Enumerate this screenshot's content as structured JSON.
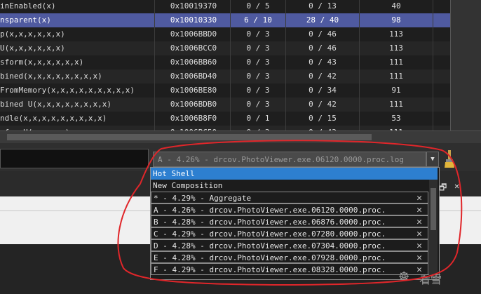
{
  "table": {
    "rows": [
      {
        "name": "inEnabled(x)",
        "address": "0x10019370",
        "col1": "0 / 5",
        "col2": "0 / 13",
        "col3": "40",
        "selected": false
      },
      {
        "name": "nsparent(x)",
        "address": "0x10010330",
        "col1": "6 / 10",
        "col2": "28 / 40",
        "col3": "98",
        "selected": true
      },
      {
        "name": "p(x,x,x,x,x,x)",
        "address": "0x1006BBD0",
        "col1": "0 / 3",
        "col2": "0 / 46",
        "col3": "113",
        "selected": false
      },
      {
        "name": "U(x,x,x,x,x,x)",
        "address": "0x1006BCC0",
        "col1": "0 / 3",
        "col2": "0 / 46",
        "col3": "113",
        "selected": false
      },
      {
        "name": "sform(x,x,x,x,x,x)",
        "address": "0x1006BB60",
        "col1": "0 / 3",
        "col2": "0 / 43",
        "col3": "111",
        "selected": false
      },
      {
        "name": "bined(x,x,x,x,x,x,x,x)",
        "address": "0x1006BD40",
        "col1": "0 / 3",
        "col2": "0 / 42",
        "col3": "111",
        "selected": false
      },
      {
        "name": "FromMemory(x,x,x,x,x,x,x,x,x)",
        "address": "0x1006BE80",
        "col1": "0 / 3",
        "col2": "0 / 34",
        "col3": "91",
        "selected": false
      },
      {
        "name": "bined U(x,x,x,x,x,x,x,x)",
        "address": "0x1006BDB0",
        "col1": "0 / 3",
        "col2": "0 / 42",
        "col3": "111",
        "selected": false
      },
      {
        "name": "ndle(x,x,x,x,x,x,x,x,x)",
        "address": "0x1006B8F0",
        "col1": "0 / 1",
        "col2": "0 / 15",
        "col3": "53",
        "selected": false
      },
      {
        "name": "sformU(x,x,x,x)",
        "address": "0x1006BC50",
        "col1": "0 / 3",
        "col2": "0 / 43",
        "col3": "111",
        "selected": false
      }
    ]
  },
  "combo": {
    "value": "A -   4.26% - drcov.PhotoViewer.exe.06120.0000.proc.log"
  },
  "dropdown": {
    "items": [
      {
        "label": "Hot Shell",
        "highlighted": true,
        "removable": false
      },
      {
        "label": "New Composition",
        "highlighted": false,
        "removable": false
      },
      {
        "label": "* -   4.29% - Aggregate",
        "highlighted": false,
        "removable": true
      },
      {
        "label": "A -   4.26% - drcov.PhotoViewer.exe.06120.0000.proc.",
        "highlighted": false,
        "removable": true
      },
      {
        "label": "B -   4.28% - drcov.PhotoViewer.exe.06876.0000.proc.",
        "highlighted": false,
        "removable": true
      },
      {
        "label": "C -   4.29% - drcov.PhotoViewer.exe.07280.0000.proc.",
        "highlighted": false,
        "removable": true
      },
      {
        "label": "D -   4.28% - drcov.PhotoViewer.exe.07304.0000.proc.",
        "highlighted": false,
        "removable": true
      },
      {
        "label": "E -   4.28% - drcov.PhotoViewer.exe.07928.0000.proc.",
        "highlighted": false,
        "removable": true
      },
      {
        "label": "F -   4.29% - drcov.PhotoViewer.exe.08328.0000.proc.",
        "highlighted": false,
        "removable": true
      }
    ]
  },
  "watermark": {
    "text": "看雪"
  },
  "colors": {
    "selection": "#4f5aa0",
    "highlight": "#2d7fd0",
    "annotation": "#e0262a"
  },
  "icons": {
    "brush": "brush-icon",
    "close": "close-icon",
    "dropdown": "chevron-down-icon",
    "restore": "restore-icon"
  }
}
